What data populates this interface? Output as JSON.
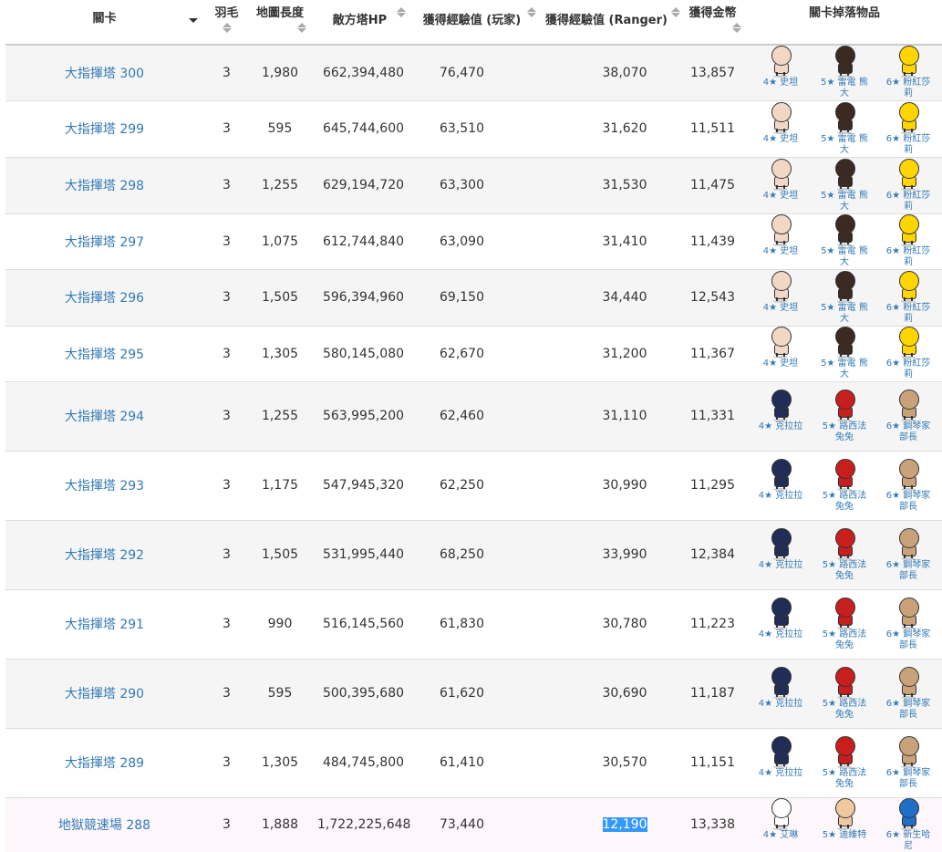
{
  "headers": {
    "level": "關卡",
    "feather": "羽毛",
    "map_length": "地圖長度",
    "tower_hp": "敵方塔HP",
    "exp_player": "獲得經驗值 (玩家)",
    "exp_ranger": "獲得經驗值 (Ranger)",
    "gold": "獲得金幣",
    "drops": "關卡掉落物品"
  },
  "sprite_colors": {
    "stan": "#f2d7c4",
    "leonard": "#3a2a22",
    "sally": "#ffd500",
    "clara": "#1f2d57",
    "lucifer": "#c81e1e",
    "pianist": "#c9a27a",
    "erin": "#ffffff",
    "dealer": "#f0c8a0",
    "sonny": "#1f6fc8"
  },
  "rows": [
    {
      "level": "大指揮塔 300",
      "feather": "3",
      "map_length": "1,980",
      "tower_hp": "662,394,480",
      "exp_player": "76,470",
      "exp_ranger": "38,070",
      "gold": "13,857",
      "drops": [
        {
          "label": "4★ 史坦",
          "icon": "stan"
        },
        {
          "label": "5★ 雷電 熊大",
          "icon": "leonard"
        },
        {
          "label": "6★ 粉紅莎莉",
          "icon": "sally"
        }
      ]
    },
    {
      "level": "大指揮塔 299",
      "feather": "3",
      "map_length": "595",
      "tower_hp": "645,744,600",
      "exp_player": "63,510",
      "exp_ranger": "31,620",
      "gold": "11,511",
      "drops": [
        {
          "label": "4★ 史坦",
          "icon": "stan"
        },
        {
          "label": "5★ 雷電 熊大",
          "icon": "leonard"
        },
        {
          "label": "6★ 粉紅莎莉",
          "icon": "sally"
        }
      ]
    },
    {
      "level": "大指揮塔 298",
      "feather": "3",
      "map_length": "1,255",
      "tower_hp": "629,194,720",
      "exp_player": "63,300",
      "exp_ranger": "31,530",
      "gold": "11,475",
      "drops": [
        {
          "label": "4★ 史坦",
          "icon": "stan"
        },
        {
          "label": "5★ 雷電 熊大",
          "icon": "leonard"
        },
        {
          "label": "6★ 粉紅莎莉",
          "icon": "sally"
        }
      ]
    },
    {
      "level": "大指揮塔 297",
      "feather": "3",
      "map_length": "1,075",
      "tower_hp": "612,744,840",
      "exp_player": "63,090",
      "exp_ranger": "31,410",
      "gold": "11,439",
      "drops": [
        {
          "label": "4★ 史坦",
          "icon": "stan"
        },
        {
          "label": "5★ 雷電 熊大",
          "icon": "leonard"
        },
        {
          "label": "6★ 粉紅莎莉",
          "icon": "sally"
        }
      ]
    },
    {
      "level": "大指揮塔 296",
      "feather": "3",
      "map_length": "1,505",
      "tower_hp": "596,394,960",
      "exp_player": "69,150",
      "exp_ranger": "34,440",
      "gold": "12,543",
      "drops": [
        {
          "label": "4★ 史坦",
          "icon": "stan"
        },
        {
          "label": "5★ 雷電 熊大",
          "icon": "leonard"
        },
        {
          "label": "6★ 粉紅莎莉",
          "icon": "sally"
        }
      ]
    },
    {
      "level": "大指揮塔 295",
      "feather": "3",
      "map_length": "1,305",
      "tower_hp": "580,145,080",
      "exp_player": "62,670",
      "exp_ranger": "31,200",
      "gold": "11,367",
      "drops": [
        {
          "label": "4★ 史坦",
          "icon": "stan"
        },
        {
          "label": "5★ 雷電 熊大",
          "icon": "leonard"
        },
        {
          "label": "6★ 粉紅莎莉",
          "icon": "sally"
        }
      ]
    },
    {
      "level": "大指揮塔 294",
      "feather": "3",
      "map_length": "1,255",
      "tower_hp": "563,995,200",
      "exp_player": "62,460",
      "exp_ranger": "31,110",
      "gold": "11,331",
      "drops": [
        {
          "label": "4★ 克拉拉",
          "icon": "clara"
        },
        {
          "label": "5★ 路西法 兔兔",
          "icon": "lucifer"
        },
        {
          "label": "6★ 鋼琴家部長",
          "icon": "pianist"
        }
      ]
    },
    {
      "level": "大指揮塔 293",
      "feather": "3",
      "map_length": "1,175",
      "tower_hp": "547,945,320",
      "exp_player": "62,250",
      "exp_ranger": "30,990",
      "gold": "11,295",
      "drops": [
        {
          "label": "4★ 克拉拉",
          "icon": "clara"
        },
        {
          "label": "5★ 路西法 兔兔",
          "icon": "lucifer"
        },
        {
          "label": "6★ 鋼琴家部長",
          "icon": "pianist"
        }
      ]
    },
    {
      "level": "大指揮塔 292",
      "feather": "3",
      "map_length": "1,505",
      "tower_hp": "531,995,440",
      "exp_player": "68,250",
      "exp_ranger": "33,990",
      "gold": "12,384",
      "drops": [
        {
          "label": "4★ 克拉拉",
          "icon": "clara"
        },
        {
          "label": "5★ 路西法 兔兔",
          "icon": "lucifer"
        },
        {
          "label": "6★ 鋼琴家部長",
          "icon": "pianist"
        }
      ]
    },
    {
      "level": "大指揮塔 291",
      "feather": "3",
      "map_length": "990",
      "tower_hp": "516,145,560",
      "exp_player": "61,830",
      "exp_ranger": "30,780",
      "gold": "11,223",
      "drops": [
        {
          "label": "4★ 克拉拉",
          "icon": "clara"
        },
        {
          "label": "5★ 路西法 兔兔",
          "icon": "lucifer"
        },
        {
          "label": "6★ 鋼琴家部長",
          "icon": "pianist"
        }
      ]
    },
    {
      "level": "大指揮塔 290",
      "feather": "3",
      "map_length": "595",
      "tower_hp": "500,395,680",
      "exp_player": "61,620",
      "exp_ranger": "30,690",
      "gold": "11,187",
      "drops": [
        {
          "label": "4★ 克拉拉",
          "icon": "clara"
        },
        {
          "label": "5★ 路西法 兔兔",
          "icon": "lucifer"
        },
        {
          "label": "6★ 鋼琴家部長",
          "icon": "pianist"
        }
      ]
    },
    {
      "level": "大指揮塔 289",
      "feather": "3",
      "map_length": "1,305",
      "tower_hp": "484,745,800",
      "exp_player": "61,410",
      "exp_ranger": "30,570",
      "gold": "11,151",
      "drops": [
        {
          "label": "4★ 克拉拉",
          "icon": "clara"
        },
        {
          "label": "5★ 路西法 兔兔",
          "icon": "lucifer"
        },
        {
          "label": "6★ 鋼琴家部長",
          "icon": "pianist"
        }
      ]
    },
    {
      "level": "地獄競速場 288",
      "feather": "3",
      "map_length": "1,888",
      "tower_hp": "1,722,225,648",
      "exp_player": "73,440",
      "exp_ranger": "12,190",
      "gold": "13,338",
      "drops": [
        {
          "label": "4★ 艾琳",
          "icon": "erin"
        },
        {
          "label": "5★ 迪維特",
          "icon": "dealer"
        },
        {
          "label": "6★ 新生哈尼",
          "icon": "sonny"
        }
      ]
    }
  ]
}
